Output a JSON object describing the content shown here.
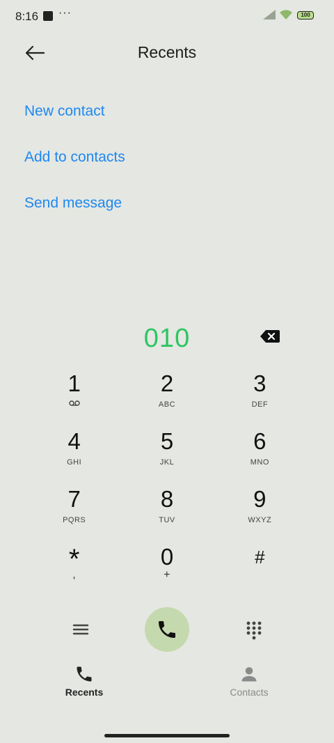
{
  "status": {
    "time": "8:16",
    "dots": "···",
    "battery": "100"
  },
  "header": {
    "title": "Recents"
  },
  "actions": [
    {
      "label": "New contact"
    },
    {
      "label": "Add to contacts"
    },
    {
      "label": "Send message"
    }
  ],
  "dialer": {
    "number": "010",
    "keys": [
      [
        {
          "digit": "1",
          "sub": ""
        },
        {
          "digit": "2",
          "sub": "ABC"
        },
        {
          "digit": "3",
          "sub": "DEF"
        }
      ],
      [
        {
          "digit": "4",
          "sub": "GHI"
        },
        {
          "digit": "5",
          "sub": "JKL"
        },
        {
          "digit": "6",
          "sub": "MNO"
        }
      ],
      [
        {
          "digit": "7",
          "sub": "PQRS"
        },
        {
          "digit": "8",
          "sub": "TUV"
        },
        {
          "digit": "9",
          "sub": "WXYZ"
        }
      ],
      [
        {
          "digit": "*",
          "sub": ","
        },
        {
          "digit": "0",
          "sub": "+"
        },
        {
          "digit": "#",
          "sub": ""
        }
      ]
    ]
  },
  "tabs": [
    {
      "label": "Recents"
    },
    {
      "label": "Contacts"
    }
  ],
  "colors": {
    "accent": "#1e88f0",
    "number": "#2ec561",
    "call_button": "#c5d9ae",
    "background": "#e4e7e2"
  },
  "icons": {
    "back": "arrow-left-icon",
    "backspace": "backspace-icon",
    "voicemail": "voicemail-icon",
    "menu": "menu-icon",
    "call": "phone-icon",
    "dialpad": "dialpad-icon",
    "recents_tab": "phone-icon",
    "contacts_tab": "person-icon"
  }
}
